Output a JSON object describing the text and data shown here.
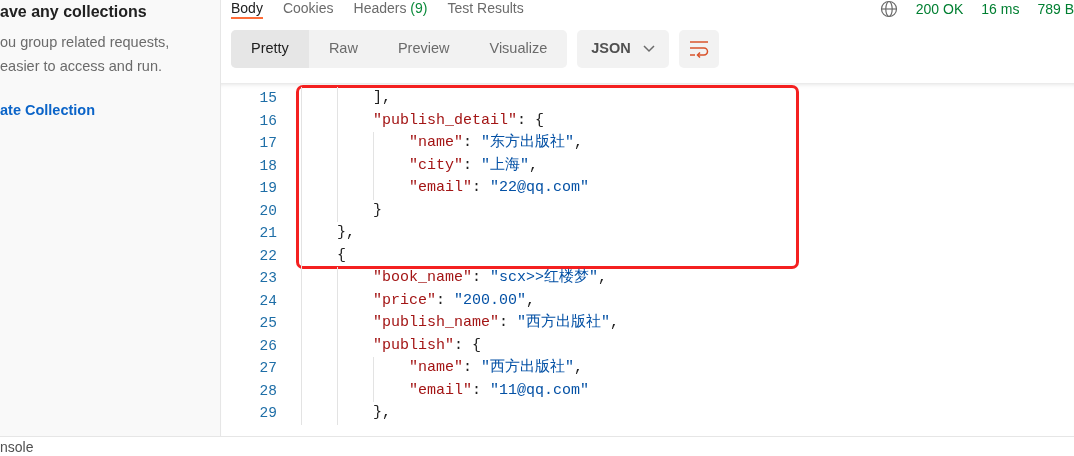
{
  "sidebar": {
    "heading": "ave any collections",
    "description_lines": [
      "ou group related requests,",
      "easier to access and run."
    ],
    "create_link": "ate Collection"
  },
  "response_tabs": [
    {
      "label": "Body",
      "selected": true
    },
    {
      "label": "Cookies",
      "selected": false
    },
    {
      "label": "Headers",
      "count": "(9)",
      "selected": false
    },
    {
      "label": "Test Results",
      "selected": false
    }
  ],
  "status": {
    "code": "200 OK",
    "time": "16 ms",
    "size": "789 B"
  },
  "view_modes": [
    {
      "label": "Pretty",
      "selected": true
    },
    {
      "label": "Raw",
      "selected": false
    },
    {
      "label": "Preview",
      "selected": false
    },
    {
      "label": "Visualize",
      "selected": false
    }
  ],
  "format": "JSON",
  "blocks": [
    {
      "highlighted": true,
      "lines": [
        {
          "number": "15",
          "tokens": [
            {
              "kind": "punct",
              "text": "        ],"
            }
          ]
        },
        {
          "number": "16",
          "tokens": [
            {
              "kind": "key",
              "text": "        \"publish_detail\""
            },
            {
              "kind": "punct",
              "text": ": {"
            }
          ]
        },
        {
          "number": "17",
          "tokens": [
            {
              "kind": "key",
              "text": "            \"name\""
            },
            {
              "kind": "punct",
              "text": ": "
            },
            {
              "kind": "string",
              "text": "\"东方出版社\""
            },
            {
              "kind": "punct",
              "text": ","
            }
          ]
        },
        {
          "number": "18",
          "tokens": [
            {
              "kind": "key",
              "text": "            \"city\""
            },
            {
              "kind": "punct",
              "text": ": "
            },
            {
              "kind": "string",
              "text": "\"上海\""
            },
            {
              "kind": "punct",
              "text": ","
            }
          ]
        },
        {
          "number": "19",
          "tokens": [
            {
              "kind": "key",
              "text": "            \"email\""
            },
            {
              "kind": "punct",
              "text": ": "
            },
            {
              "kind": "string",
              "text": "\"22@qq.com\""
            }
          ]
        },
        {
          "number": "20",
          "tokens": [
            {
              "kind": "punct",
              "text": "        }"
            }
          ]
        },
        {
          "number": "21",
          "tokens": [
            {
              "kind": "punct",
              "text": "    },"
            }
          ]
        },
        {
          "number": "22",
          "tokens": [
            {
              "kind": "punct",
              "text": "    {"
            }
          ]
        }
      ]
    },
    {
      "highlighted": false,
      "lines": [
        {
          "number": "23",
          "tokens": [
            {
              "kind": "key",
              "text": "        \"book_name\""
            },
            {
              "kind": "punct",
              "text": ": "
            },
            {
              "kind": "string",
              "text": "\"scx>>红楼梦\""
            },
            {
              "kind": "punct",
              "text": ","
            }
          ]
        },
        {
          "number": "24",
          "tokens": [
            {
              "kind": "key",
              "text": "        \"price\""
            },
            {
              "kind": "punct",
              "text": ": "
            },
            {
              "kind": "string",
              "text": "\"200.00\""
            },
            {
              "kind": "punct",
              "text": ","
            }
          ]
        },
        {
          "number": "25",
          "tokens": [
            {
              "kind": "key",
              "text": "        \"publish_name\""
            },
            {
              "kind": "punct",
              "text": ": "
            },
            {
              "kind": "string",
              "text": "\"西方出版社\""
            },
            {
              "kind": "punct",
              "text": ","
            }
          ]
        },
        {
          "number": "26",
          "tokens": [
            {
              "kind": "key",
              "text": "        \"publish\""
            },
            {
              "kind": "punct",
              "text": ": {"
            }
          ]
        },
        {
          "number": "27",
          "tokens": [
            {
              "kind": "key",
              "text": "            \"name\""
            },
            {
              "kind": "punct",
              "text": ": "
            },
            {
              "kind": "string",
              "text": "\"西方出版社\""
            },
            {
              "kind": "punct",
              "text": ","
            }
          ]
        },
        {
          "number": "28",
          "tokens": [
            {
              "kind": "key",
              "text": "            \"email\""
            },
            {
              "kind": "punct",
              "text": ": "
            },
            {
              "kind": "string",
              "text": "\"11@qq.com\""
            }
          ]
        },
        {
          "number": "29",
          "tokens": [
            {
              "kind": "punct",
              "text": "        },"
            }
          ]
        }
      ]
    }
  ],
  "footer": {
    "console": "nsole"
  }
}
